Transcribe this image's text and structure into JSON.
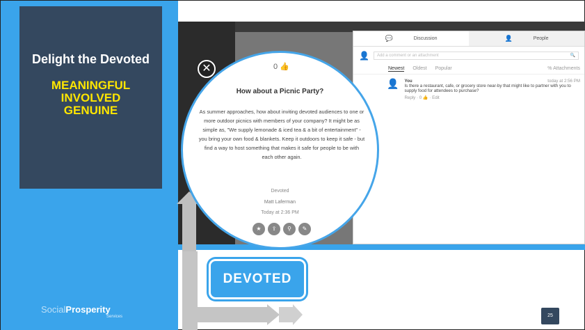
{
  "slide": {
    "title": "Delight the Devoted",
    "subtitle_lines": [
      "MEANINGFUL",
      "INVOLVED",
      "GENUINE"
    ],
    "page_number": "25",
    "badge_label": "DEVOTED"
  },
  "logo": {
    "part1": "Social",
    "part2": "Prosperity",
    "sub": "Services"
  },
  "app": {
    "tabs": [
      {
        "label": "Discussion",
        "icon": "chat-icon"
      },
      {
        "label": "People",
        "icon": "person-icon"
      }
    ],
    "comment_input_placeholder": "Add a comment or an attachment",
    "sort_options": [
      "Newest",
      "Oldest",
      "Popular"
    ],
    "attachments_label": "% Attachments",
    "comment": {
      "author": "You",
      "time": "today at 2:56 PM",
      "text": "Is there a restaurant, cafe, or grocery store near-by that might like to partner with you to supply food for attendees to purchase?",
      "meta": "Reply · 0 👍 · Edit"
    }
  },
  "post": {
    "likes": "0",
    "title": "How about a Picnic Party?",
    "body": "As summer approaches, how about inviting devoted audiences to one or more outdoor picnics with members of your company? It might be as simple as, \"We supply lemonade & iced tea & a bit of entertainment\" - you bring your own food & blankets. Keep it outdoors to keep it safe - but find a way to host something that makes it safe for people to be with each other again.",
    "category": "Devoted",
    "author": "Matt Laferman",
    "time": "Today at 2:36 PM"
  },
  "colors": {
    "panel_blue": "#3aa4eb",
    "title_box": "#34485f",
    "highlight_yellow": "#ffe600"
  }
}
